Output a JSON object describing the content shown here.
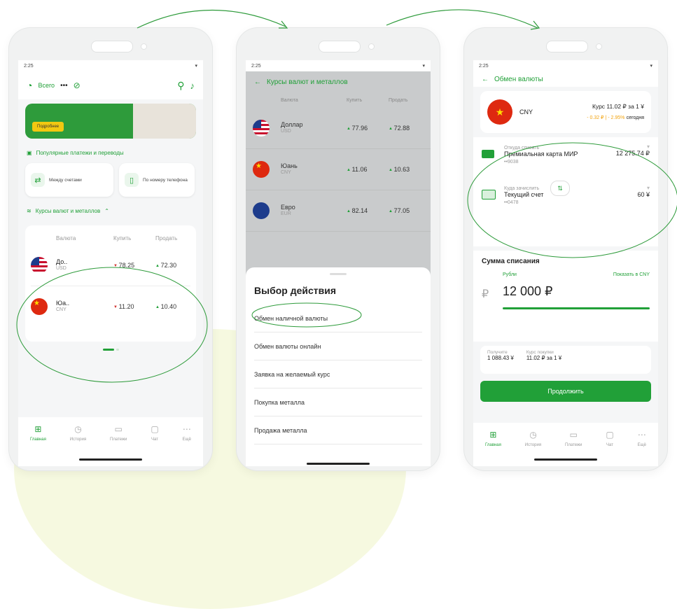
{
  "colors": {
    "accent": "#21a038",
    "up": "#21a038",
    "down": "#d0312d"
  },
  "status": {
    "time": "2:25"
  },
  "phone1": {
    "header": {
      "label": "Всего",
      "dots": "•••"
    },
    "banner": {
      "button": "Подробнее"
    },
    "popular_title": "Популярные платежи и переводы",
    "quick": [
      {
        "label": "Между счетами"
      },
      {
        "label": "По номеру телефона"
      }
    ],
    "rates_title": "Курсы валют и металлов",
    "rates_cols": [
      "Валюта",
      "Купить",
      "Продать"
    ],
    "rates": [
      {
        "name": "До..",
        "code": "USD",
        "buy": "78.25",
        "sell": "72.30"
      },
      {
        "name": "Юа..",
        "code": "CNY",
        "buy": "11.20",
        "sell": "10.40"
      }
    ]
  },
  "tabs": [
    "Главная",
    "История",
    "Платежи",
    "Чат",
    "Ещё"
  ],
  "phone2": {
    "title": "Курсы валют и металлов",
    "cols": [
      "Валюта",
      "Купить",
      "Продать"
    ],
    "rows": [
      {
        "name": "Доллар",
        "code": "USD",
        "buy": "77.96",
        "sell": "72.88"
      },
      {
        "name": "Юань",
        "code": "CNY",
        "buy": "11.06",
        "sell": "10.63"
      },
      {
        "name": "Евро",
        "code": "EUR",
        "buy": "82.14",
        "sell": "77.05"
      }
    ],
    "sheet_title": "Выбор действия",
    "options": [
      "Обмен наличной валюты",
      "Обмен валюты онлайн",
      "Заявка на желаемый курс",
      "Покупка металла",
      "Продажа металла"
    ]
  },
  "phone3": {
    "title": "Обмен валюты",
    "currency": "CNY",
    "rate": "Курс 11.02 ₽ за 1 ¥",
    "change": "- 0.32 ₽ | - 2.95%",
    "change_when": "сегодня",
    "from_label": "Откуда списать",
    "from_name": "Премиальная карта МИР",
    "from_num": "••9038",
    "from_balance": "12 275.74 ₽",
    "to_label": "Куда зачислить",
    "to_name": "Текущий счет",
    "to_num": "••0478",
    "to_balance": "60 ¥",
    "sum_title": "Сумма списания",
    "sum_currency": "Рубли",
    "sum_show": "Показать в CNY",
    "sum_amount": "12 000 ₽",
    "receive_label": "Получите",
    "receive_value": "1 088.43 ¥",
    "buy_rate_label": "Курс покупки",
    "buy_rate_value": "11.02 ₽ за 1 ¥",
    "cta": "Продолжить"
  }
}
